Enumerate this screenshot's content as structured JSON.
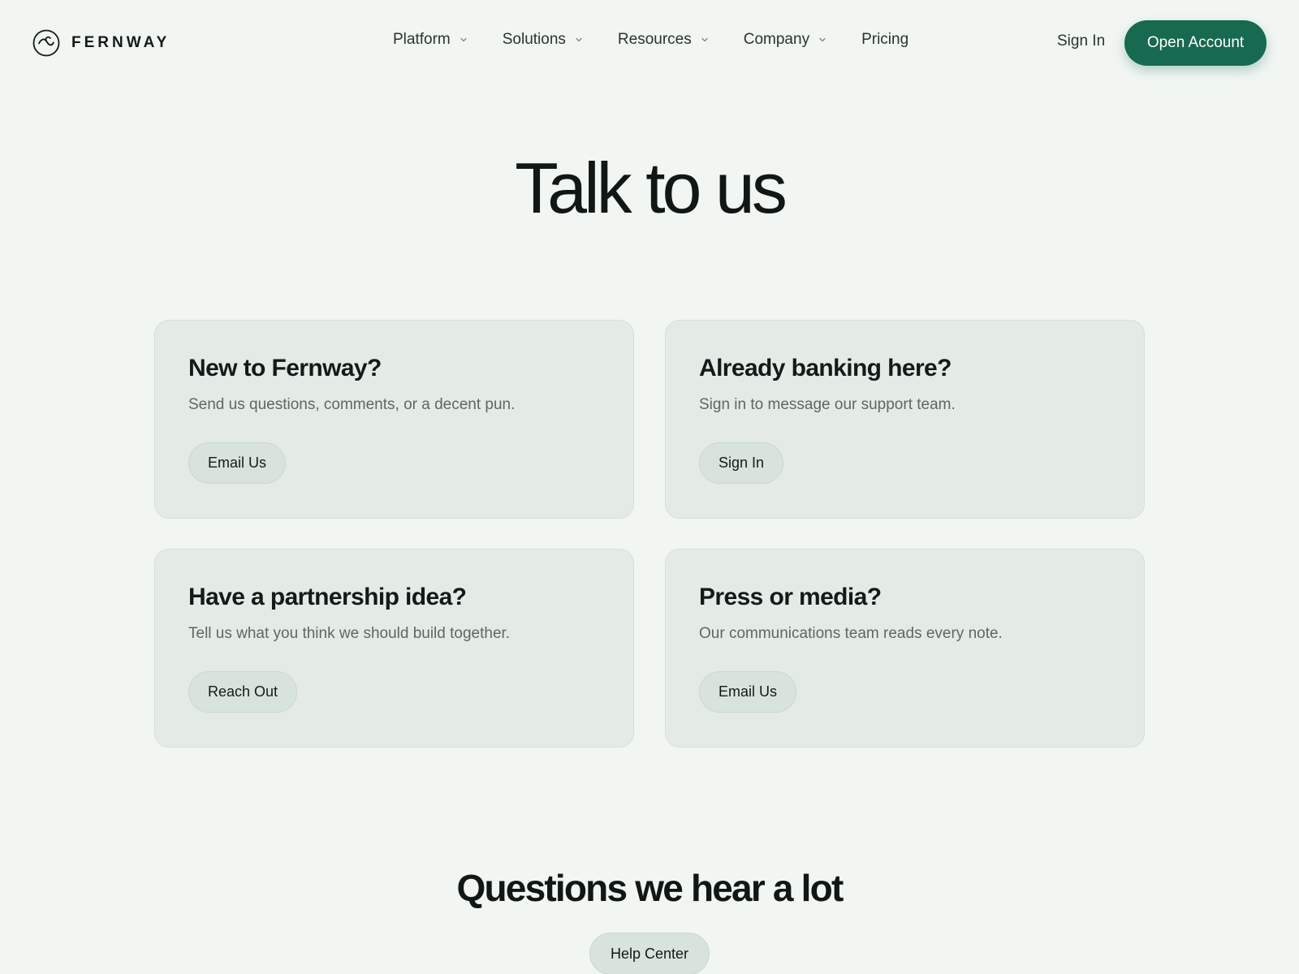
{
  "brand": {
    "name": "FERNWAY",
    "logo_icon": "spiral-logo-icon"
  },
  "nav": {
    "items": [
      {
        "label": "Platform",
        "has_dropdown": true
      },
      {
        "label": "Solutions",
        "has_dropdown": true
      },
      {
        "label": "Resources",
        "has_dropdown": true
      },
      {
        "label": "Company",
        "has_dropdown": true
      },
      {
        "label": "Pricing",
        "has_dropdown": false
      }
    ],
    "sign_in_label": "Sign In",
    "open_account_label": "Open Account"
  },
  "hero": {
    "title": "Talk to us"
  },
  "cards": [
    {
      "title": "New to Fernway?",
      "description": "Send us questions, comments, or a decent pun.",
      "button_label": "Email Us"
    },
    {
      "title": "Already banking here?",
      "description": "Sign in to message our support team.",
      "button_label": "Sign In"
    },
    {
      "title": "Have a partnership idea?",
      "description": "Tell us what you think we should build together.",
      "button_label": "Reach Out"
    },
    {
      "title": "Press or media?",
      "description": "Our communications team reads every note.",
      "button_label": "Email Us"
    }
  ],
  "faq": {
    "title": "Questions we hear a lot",
    "help_center_label": "Help Center"
  },
  "colors": {
    "background": "#f1f6f3",
    "card_background": "#e4ebe7",
    "accent": "#17694f",
    "pill_background": "#d9e3de",
    "text_primary": "#141a17",
    "text_muted": "#5d6863"
  }
}
